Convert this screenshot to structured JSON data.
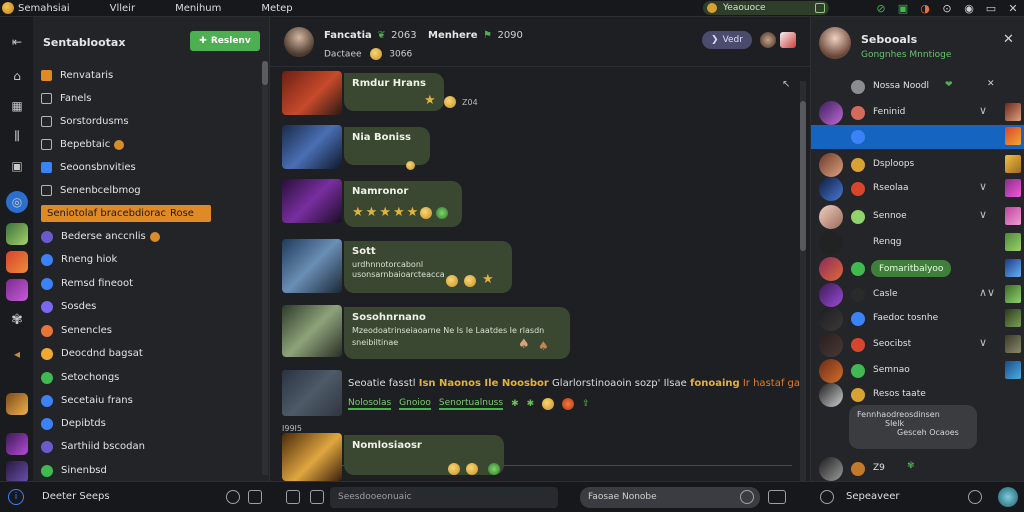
{
  "topbar": {
    "menu": [
      "Semahsiai",
      "Vlleir",
      "Menihum",
      "Metep"
    ],
    "pill_label": "Yeaouoce",
    "window_icons": [
      "⊘",
      "▣",
      "◑",
      "⊙",
      "◉",
      "▭",
      "✕"
    ]
  },
  "rail": {
    "icons": [
      "back-icon",
      "home-icon",
      "grid-icon",
      "sliders-icon",
      "box-icon",
      "globe-icon",
      "app-icon-1",
      "app-icon-2",
      "app-icon-3",
      "app-icon-4",
      "arrow-icon",
      "app-icon-5",
      "app-icon-6",
      "app-icon-7"
    ]
  },
  "sidebar": {
    "title": "Sentablootax",
    "new_label": "Reslenv",
    "channels": [
      {
        "label": "Renvataris",
        "type": "box",
        "color": "#e08a25"
      },
      {
        "label": "Fanels",
        "type": "box",
        "color": ""
      },
      {
        "label": "Sorstordusms",
        "type": "box",
        "color": ""
      },
      {
        "label": "Bepebtaic",
        "type": "box",
        "color": ""
      },
      {
        "label": "Seoonsbnvities",
        "type": "box",
        "color": "#3b82f6"
      },
      {
        "label": "Senenbcelbmog",
        "type": "box",
        "color": ""
      },
      {
        "label": "Seniotolaf bracebdiorac",
        "type": "active",
        "color": "#e08a25",
        "tag": "Rose"
      },
      {
        "label": "Bederse anccnlis",
        "type": "circ",
        "color": "#6a5acd"
      },
      {
        "label": "Rneng hiok",
        "type": "circ",
        "color": "#3b82f6"
      },
      {
        "label": "Remsd fineoot",
        "type": "circ",
        "color": "#3b82f6"
      },
      {
        "label": "Sosdes",
        "type": "circ",
        "color": "#7b68ee"
      },
      {
        "label": "Senencles",
        "type": "circ",
        "color": "#e8743b"
      },
      {
        "label": "Deocdnd bagsat",
        "type": "circ",
        "color": "#f0a830"
      },
      {
        "label": "Setochongs",
        "type": "circ",
        "color": "#3fb950"
      },
      {
        "label": "Secetaiu frans",
        "type": "circ",
        "color": "#3b82f6"
      },
      {
        "label": "Depibtds",
        "type": "circ",
        "color": "#3b82f6"
      },
      {
        "label": "Sarthiid bscodan",
        "type": "circ",
        "color": "#6a5acd"
      },
      {
        "label": "Sinenbsd",
        "type": "circ",
        "color": "#3fb950"
      }
    ]
  },
  "main": {
    "header": {
      "name": "Fancatia",
      "name_badge": "2063",
      "name2": "Menhere",
      "name2_badge": "2090",
      "sub": "Dactaee",
      "sub_badge": "3066",
      "view_label": "Vedr"
    },
    "messages": [
      {
        "title": "Rmdur Hrans",
        "line2": "",
        "meta": "Z04"
      },
      {
        "title": "Nia Boniss",
        "line2": "",
        "meta": ""
      },
      {
        "title": "Namronor",
        "line2": "",
        "meta": ""
      },
      {
        "title": "Sott",
        "line2": "urdhnnotorcabonl",
        "line3": "usonsarnbaioarcteacca",
        "meta": ""
      },
      {
        "title": "Sosohnrnano",
        "line2": "Mzeodoatrinseiaoarne Ne Is Ie Laatdes Ie rlasdn",
        "line3": "sneibiltinae",
        "meta": ""
      },
      {
        "title": "Nomlosiaosr",
        "line2": "",
        "meta": ""
      }
    ],
    "wide": {
      "text": "Seoatie fasstl",
      "text_b": "Isn Naonos Ile Noosbor",
      "text_c": "Glarlorstinoaoin sozp' Ilsae",
      "text_d": "fonoaing",
      "text_e": "Ir hastaf ganor",
      "links": [
        "Nolosolas",
        "Gnoioo",
        "Senortualnuss"
      ],
      "time": "I99I5"
    }
  },
  "bottombar": {
    "status": "Deeter Seeps",
    "search_placeholder": "Seesdooeonuaic",
    "search2_placeholder": "Faosae Nonobe",
    "right_text": "Sepeaveer"
  },
  "right": {
    "name": "Sebooals",
    "sub": "Gongnhes Mnntioge",
    "top_row": "Nossa Noodl",
    "rows": [
      {
        "label": "Feninid",
        "chev": "∨"
      },
      {
        "label": "",
        "chev": "",
        "selected": true
      },
      {
        "label": "Dsploops",
        "chev": ""
      },
      {
        "label": "Rseolaa",
        "chev": "∨"
      },
      {
        "label": "Sennoe",
        "chev": "∨"
      },
      {
        "label": "Renqg",
        "chev": ""
      },
      {
        "label": "Fomaritbalyoo",
        "chev": "",
        "pill": true
      },
      {
        "label": "Casle",
        "chev": "∧∨"
      },
      {
        "label": "Faedoc tosnhe",
        "chev": ""
      },
      {
        "label": "Seocibst",
        "chev": "∨"
      },
      {
        "label": "Semnao",
        "chev": ""
      },
      {
        "label": "Resos taate",
        "chev": ""
      }
    ],
    "bubble_l1": "Fennhaodreosdinsen",
    "bubble_l2": "Slelk",
    "bubble_l3": "Gesceh Ocaoes",
    "bottom_row": "Z9"
  }
}
